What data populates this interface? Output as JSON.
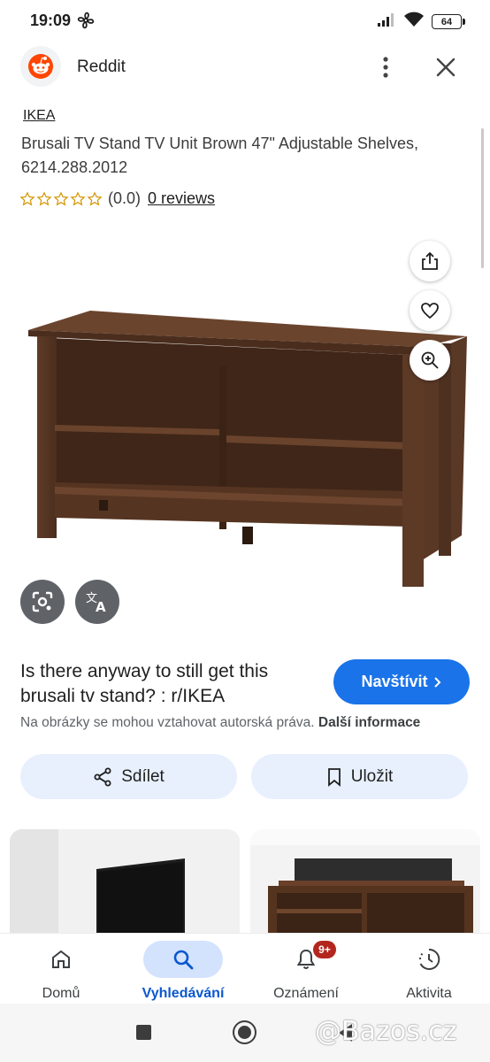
{
  "status_bar": {
    "time": "19:09",
    "battery": "64"
  },
  "header": {
    "app_name": "Reddit",
    "icons": [
      "reddit-logo-icon",
      "more-vert-icon",
      "close-icon"
    ]
  },
  "product": {
    "brand": "IKEA",
    "title": "Brusali TV Stand TV Unit Brown 47\" Adjustable Shelves, 6214.288.2012",
    "rating_value": "(0.0)",
    "reviews_label": "0 reviews",
    "stars_filled": 0,
    "stars_total": 5
  },
  "image_actions": {
    "icons": [
      "share-icon",
      "heart-icon",
      "zoom-in-icon",
      "lens-icon",
      "translate-icon"
    ]
  },
  "result": {
    "title": "Is there anyway to still get this brusali tv stand? : r/IKEA",
    "visit_label": "Navštívit",
    "copyright_text": "Na obrázky se mohou vztahovat autorská práva.",
    "more_info_label": "Další informace",
    "share_label": "Sdílet",
    "save_label": "Uložit"
  },
  "bottom_nav": {
    "items": [
      {
        "label": "Domů",
        "icon": "home-icon"
      },
      {
        "label": "Vyhledávání",
        "icon": "search-icon"
      },
      {
        "label": "Oznámení",
        "icon": "bell-icon",
        "badge": "9+"
      },
      {
        "label": "Aktivita",
        "icon": "activity-icon"
      }
    ],
    "active_index": 1
  },
  "watermark": "@Bazos.cz",
  "colors": {
    "primary_blue": "#1a73e8",
    "active_nav": "#d3e3fd",
    "pill_bg": "#e8f0fe",
    "badge_red": "#b3261e",
    "wood": "#5a3826"
  }
}
